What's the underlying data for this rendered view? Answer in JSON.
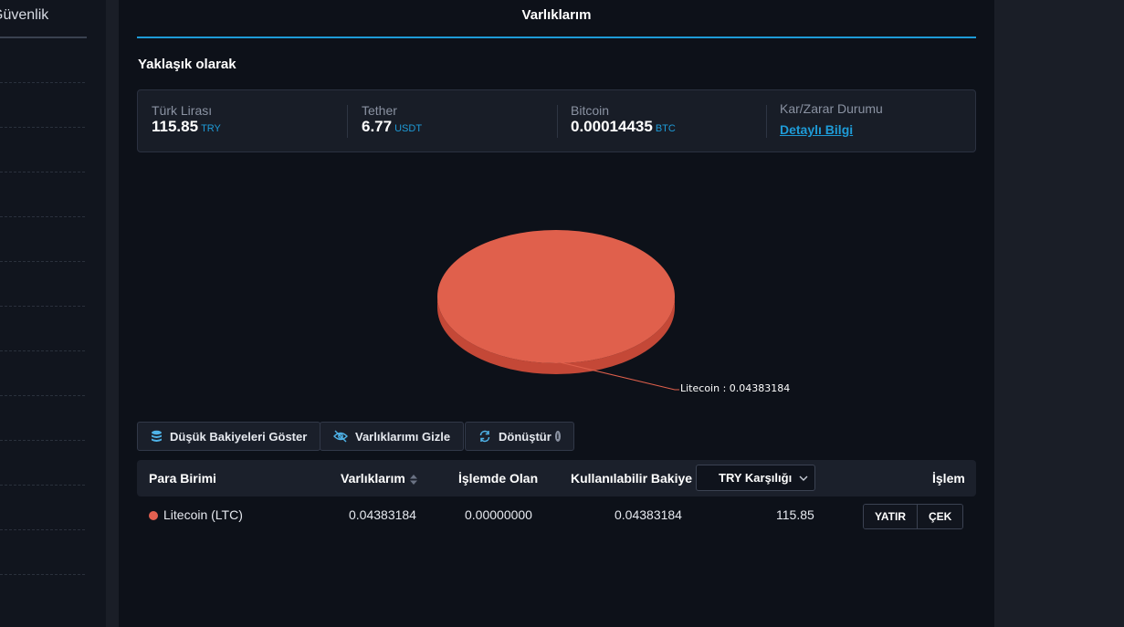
{
  "sidebar": {
    "title": "Güvenlik",
    "separator_count": 12
  },
  "header": {
    "title": "Varlıklarım",
    "accent_color": "#1e9bd7"
  },
  "approx_label": "Yaklaşık olarak",
  "summary": {
    "items": [
      {
        "label": "Türk Lirası",
        "value": "115.85",
        "unit": "TRY"
      },
      {
        "label": "Tether",
        "value": "6.77",
        "unit": "USDT"
      },
      {
        "label": "Bitcoin",
        "value": "0.00014435",
        "unit": "BTC"
      }
    ],
    "pnl": {
      "label": "Kar/Zarar Durumu",
      "link": "Detaylı Bilgi"
    }
  },
  "chart_data": {
    "type": "pie",
    "slices": [
      {
        "name": "Litecoin",
        "value": 0.04383184,
        "color": "#e0604c"
      }
    ],
    "data_labels": [
      "Litecoin : 0.04383184"
    ]
  },
  "buttons": {
    "low_balances": "Düşük Bakiyeleri Göster",
    "hide_assets": "Varlıklarımı Gizle",
    "convert": "Dönüştür",
    "convert_info": "i"
  },
  "table": {
    "headers": {
      "currency": "Para Birimi",
      "assets": "Varlıklarım",
      "in_order": "İşlemde Olan",
      "available": "Kullanılabilir Bakiye",
      "equivalent_select": "TRY Karşılığı",
      "action": "İşlem"
    },
    "rows": [
      {
        "currency": "Litecoin (LTC)",
        "dot_color": "#e36050",
        "assets": "0.04383184",
        "in_order": "0.00000000",
        "available": "0.04383184",
        "equivalent": "115.85",
        "deposit": "YATIR",
        "withdraw": "ÇEK"
      }
    ]
  }
}
